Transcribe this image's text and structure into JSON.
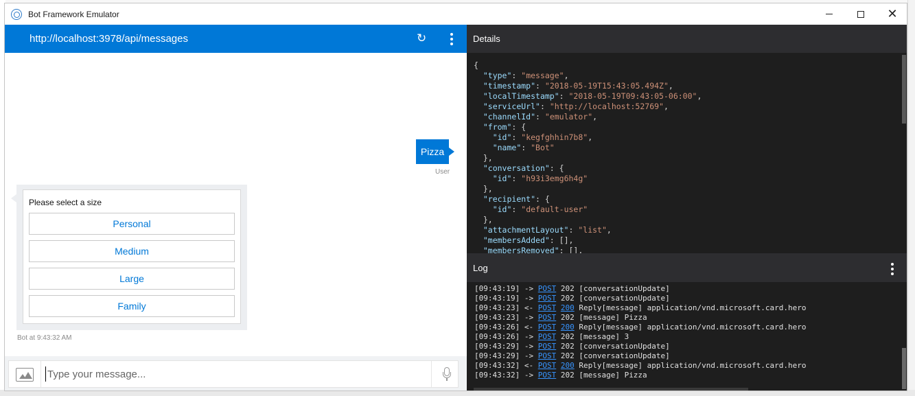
{
  "window": {
    "title": "Bot Framework Emulator",
    "icon": "bot-emulator-icon"
  },
  "chat": {
    "endpoint_url": "http://localhost:3978/api/messages",
    "user_message": "Pizza",
    "user_label": "User",
    "bot_card": {
      "text": "Please select a size",
      "buttons": [
        "Personal",
        "Medium",
        "Large",
        "Family"
      ]
    },
    "bot_timestamp": "Bot at 9:43:32 AM",
    "input_placeholder": "Type your message..."
  },
  "details": {
    "title": "Details",
    "json_lines": [
      [
        {
          "t": "p",
          "v": "{"
        }
      ],
      [
        {
          "t": "p",
          "v": "  "
        },
        {
          "t": "k",
          "v": "\"type\""
        },
        {
          "t": "p",
          "v": ": "
        },
        {
          "t": "s",
          "v": "\"message\""
        },
        {
          "t": "p",
          "v": ","
        }
      ],
      [
        {
          "t": "p",
          "v": "  "
        },
        {
          "t": "k",
          "v": "\"timestamp\""
        },
        {
          "t": "p",
          "v": ": "
        },
        {
          "t": "s",
          "v": "\"2018-05-19T15:43:05.494Z\""
        },
        {
          "t": "p",
          "v": ","
        }
      ],
      [
        {
          "t": "p",
          "v": "  "
        },
        {
          "t": "k",
          "v": "\"localTimestamp\""
        },
        {
          "t": "p",
          "v": ": "
        },
        {
          "t": "s",
          "v": "\"2018-05-19T09:43:05-06:00\""
        },
        {
          "t": "p",
          "v": ","
        }
      ],
      [
        {
          "t": "p",
          "v": "  "
        },
        {
          "t": "k",
          "v": "\"serviceUrl\""
        },
        {
          "t": "p",
          "v": ": "
        },
        {
          "t": "s",
          "v": "\"http://localhost:52769\""
        },
        {
          "t": "p",
          "v": ","
        }
      ],
      [
        {
          "t": "p",
          "v": "  "
        },
        {
          "t": "k",
          "v": "\"channelId\""
        },
        {
          "t": "p",
          "v": ": "
        },
        {
          "t": "s",
          "v": "\"emulator\""
        },
        {
          "t": "p",
          "v": ","
        }
      ],
      [
        {
          "t": "p",
          "v": "  "
        },
        {
          "t": "k",
          "v": "\"from\""
        },
        {
          "t": "p",
          "v": ": {"
        }
      ],
      [
        {
          "t": "p",
          "v": "    "
        },
        {
          "t": "k",
          "v": "\"id\""
        },
        {
          "t": "p",
          "v": ": "
        },
        {
          "t": "s",
          "v": "\"kegfghhin7b8\""
        },
        {
          "t": "p",
          "v": ","
        }
      ],
      [
        {
          "t": "p",
          "v": "    "
        },
        {
          "t": "k",
          "v": "\"name\""
        },
        {
          "t": "p",
          "v": ": "
        },
        {
          "t": "s",
          "v": "\"Bot\""
        }
      ],
      [
        {
          "t": "p",
          "v": "  },"
        }
      ],
      [
        {
          "t": "p",
          "v": "  "
        },
        {
          "t": "k",
          "v": "\"conversation\""
        },
        {
          "t": "p",
          "v": ": {"
        }
      ],
      [
        {
          "t": "p",
          "v": "    "
        },
        {
          "t": "k",
          "v": "\"id\""
        },
        {
          "t": "p",
          "v": ": "
        },
        {
          "t": "s",
          "v": "\"h93i3emg6h4g\""
        }
      ],
      [
        {
          "t": "p",
          "v": "  },"
        }
      ],
      [
        {
          "t": "p",
          "v": "  "
        },
        {
          "t": "k",
          "v": "\"recipient\""
        },
        {
          "t": "p",
          "v": ": {"
        }
      ],
      [
        {
          "t": "p",
          "v": "    "
        },
        {
          "t": "k",
          "v": "\"id\""
        },
        {
          "t": "p",
          "v": ": "
        },
        {
          "t": "s",
          "v": "\"default-user\""
        }
      ],
      [
        {
          "t": "p",
          "v": "  },"
        }
      ],
      [
        {
          "t": "p",
          "v": "  "
        },
        {
          "t": "k",
          "v": "\"attachmentLayout\""
        },
        {
          "t": "p",
          "v": ": "
        },
        {
          "t": "s",
          "v": "\"list\""
        },
        {
          "t": "p",
          "v": ","
        }
      ],
      [
        {
          "t": "p",
          "v": "  "
        },
        {
          "t": "k",
          "v": "\"membersAdded\""
        },
        {
          "t": "p",
          "v": ": [],"
        }
      ],
      [
        {
          "t": "p",
          "v": "  "
        },
        {
          "t": "k",
          "v": "\"membersRemoved\""
        },
        {
          "t": "p",
          "v": ": [],"
        }
      ]
    ]
  },
  "log": {
    "title": "Log",
    "entries": [
      {
        "time": "[09:43:19]",
        "dir": "->",
        "method": "POST",
        "status": "202",
        "status_link": false,
        "msg": "[conversationUpdate]"
      },
      {
        "time": "[09:43:19]",
        "dir": "->",
        "method": "POST",
        "status": "202",
        "status_link": false,
        "msg": "[conversationUpdate]"
      },
      {
        "time": "[09:43:23]",
        "dir": "<-",
        "method": "POST",
        "status": "200",
        "status_link": true,
        "msg": "Reply[message] application/vnd.microsoft.card.hero"
      },
      {
        "time": "[09:43:23]",
        "dir": "->",
        "method": "POST",
        "status": "202",
        "status_link": false,
        "msg": "[message] Pizza"
      },
      {
        "time": "[09:43:26]",
        "dir": "<-",
        "method": "POST",
        "status": "200",
        "status_link": true,
        "msg": "Reply[message] application/vnd.microsoft.card.hero"
      },
      {
        "time": "[09:43:26]",
        "dir": "->",
        "method": "POST",
        "status": "202",
        "status_link": false,
        "msg": "[message] 3"
      },
      {
        "time": "[09:43:29]",
        "dir": "->",
        "method": "POST",
        "status": "202",
        "status_link": false,
        "msg": "[conversationUpdate]"
      },
      {
        "time": "[09:43:29]",
        "dir": "->",
        "method": "POST",
        "status": "202",
        "status_link": false,
        "msg": "[conversationUpdate]"
      },
      {
        "time": "[09:43:32]",
        "dir": "<-",
        "method": "POST",
        "status": "200",
        "status_link": true,
        "msg": "Reply[message] application/vnd.microsoft.card.hero"
      },
      {
        "time": "[09:43:32]",
        "dir": "->",
        "method": "POST",
        "status": "202",
        "status_link": false,
        "msg": "[message] Pizza"
      }
    ]
  },
  "colors": {
    "accent": "#0078d7",
    "panel_bg": "#1e1e1e",
    "panel_header": "#2d2d30",
    "json_key": "#9cdcfe",
    "json_string": "#ce9178",
    "log_link": "#3794ff"
  }
}
